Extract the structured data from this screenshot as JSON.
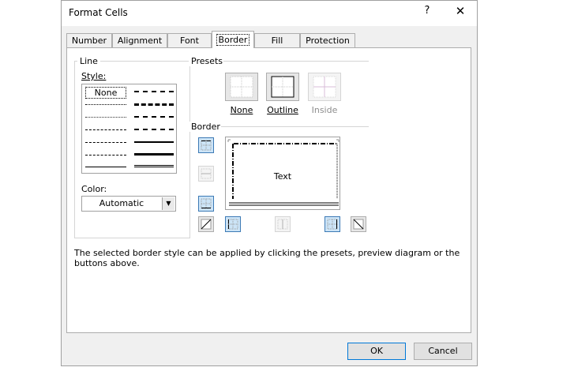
{
  "dialog": {
    "title": "Format Cells",
    "help_label": "?",
    "close_label": "✕"
  },
  "tabs": [
    {
      "label": "Number"
    },
    {
      "label": "Alignment"
    },
    {
      "label": "Font"
    },
    {
      "label": "Border",
      "active": true
    },
    {
      "label": "Fill"
    },
    {
      "label": "Protection"
    }
  ],
  "line": {
    "group_label": "Line",
    "style_label": "Style:",
    "style_none": "None",
    "color_label": "Color:",
    "color_value": "Automatic"
  },
  "presets": {
    "group_label": "Presets",
    "items": [
      {
        "label": "None"
      },
      {
        "label": "Outline"
      },
      {
        "label": "Inside",
        "disabled": true
      }
    ]
  },
  "border": {
    "group_label": "Border",
    "preview_text": "Text"
  },
  "hint": "The selected border style can be applied by clicking the presets, preview diagram or the buttons above.",
  "buttons": {
    "ok": "OK",
    "cancel": "Cancel"
  },
  "colors": {
    "selected_bg": "#cce4f7",
    "selected_border": "#3d7ab5",
    "default_button_border": "#0078d7"
  }
}
